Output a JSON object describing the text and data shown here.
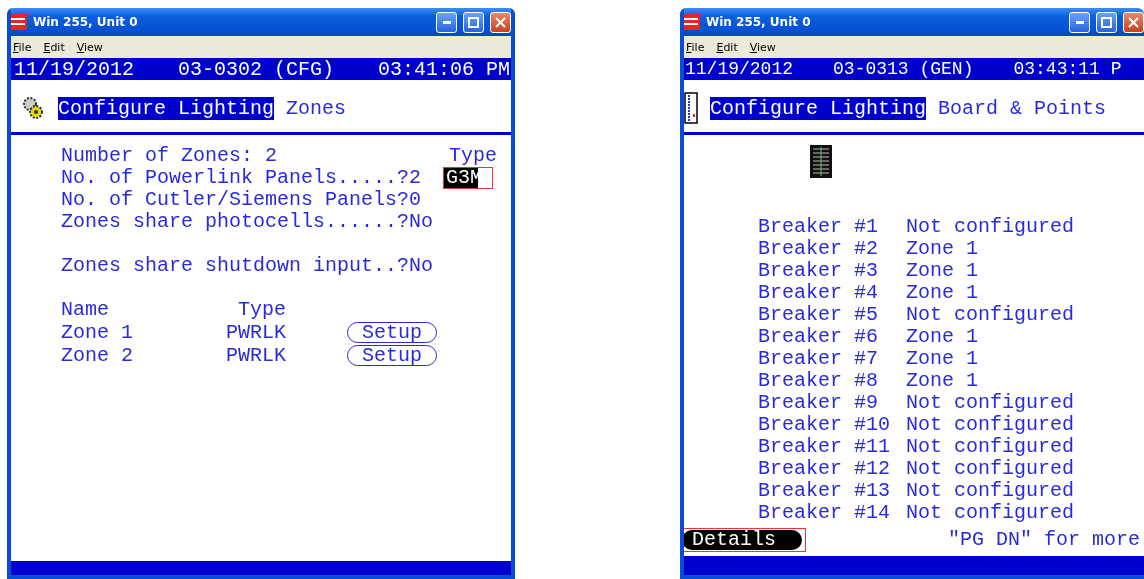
{
  "windows": [
    {
      "kind": "zones",
      "title": "Win 255, Unit 0",
      "menu": [
        "File",
        "Edit",
        "View"
      ],
      "status": {
        "date": "11/19/2012",
        "code": "03-0302 (CFG)",
        "time": "03:41:06 PM"
      },
      "heading": {
        "highlight": "Configure Lighting",
        "rest": "Zones"
      },
      "settings": [
        "Number of Zones: 2",
        "No. of Powerlink Panels.....?2",
        "No. of Cutler/Siemens Panels?0",
        "Zones share photocells......?No"
      ],
      "shutdown_setting": "Zones share shutdown input..?No",
      "type_label": "Type",
      "type_value": {
        "text": "G3M",
        "selected": true
      },
      "zone_columns": [
        "Name",
        "Type"
      ],
      "zones": [
        {
          "name": "Zone 1",
          "type": "PWRLK",
          "action": "Setup"
        },
        {
          "name": "Zone 2",
          "type": "PWRLK",
          "action": "Setup"
        }
      ]
    },
    {
      "kind": "breakers",
      "title": "Win 255, Unit 0",
      "menu": [
        "File",
        "Edit",
        "View"
      ],
      "status": {
        "date": "11/19/2012",
        "code": "03-0313 (GEN)",
        "time": "03:43:11 P"
      },
      "heading": {
        "highlight": "Configure Lighting",
        "rest": "Board & Points"
      },
      "breakers": [
        {
          "name": "Breaker #1",
          "status": "Not configured"
        },
        {
          "name": "Breaker #2",
          "status": "Zone 1"
        },
        {
          "name": "Breaker #3",
          "status": "Zone 1"
        },
        {
          "name": "Breaker #4",
          "status": "Zone 1"
        },
        {
          "name": "Breaker #5",
          "status": "Not configured"
        },
        {
          "name": "Breaker #6",
          "status": "Zone 1"
        },
        {
          "name": "Breaker #7",
          "status": "Zone 1"
        },
        {
          "name": "Breaker #8",
          "status": "Zone 1"
        },
        {
          "name": "Breaker #9",
          "status": "Not configured"
        },
        {
          "name": "Breaker #10",
          "status": "Not configured"
        },
        {
          "name": "Breaker #11",
          "status": "Not configured"
        },
        {
          "name": "Breaker #12",
          "status": "Not configured"
        },
        {
          "name": "Breaker #13",
          "status": "Not configured"
        },
        {
          "name": "Breaker #14",
          "status": "Not configured"
        }
      ],
      "details": {
        "label": "Details",
        "selected": true
      },
      "hint": "\"PG DN\" for more"
    }
  ]
}
